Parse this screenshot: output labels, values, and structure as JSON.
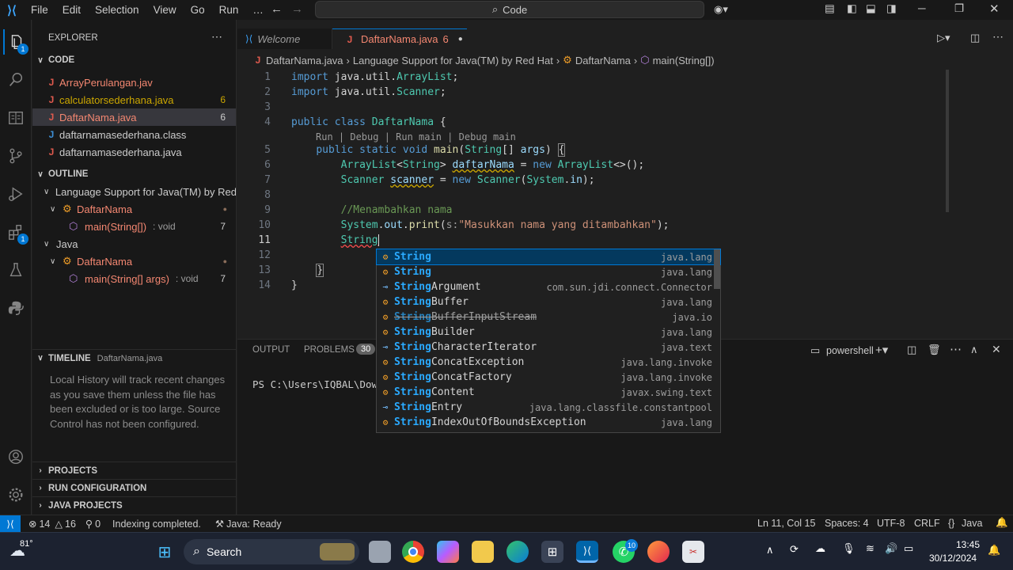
{
  "titlebar": {
    "menus": [
      "File",
      "Edit",
      "Selection",
      "View",
      "Go",
      "Run"
    ],
    "search": "Code",
    "more": "…"
  },
  "sidebar": {
    "explorer_title": "EXPLORER",
    "folder": "CODE",
    "files": [
      {
        "name": "ArrayPerulangan.jav",
        "count": ""
      },
      {
        "name": "calculatorsederhana.java",
        "count": "6"
      },
      {
        "name": "DaftarNama.java",
        "count": "6"
      },
      {
        "name": "daftarnamasederhana.class",
        "count": ""
      },
      {
        "name": "daftarnamasederhana.java",
        "count": ""
      }
    ],
    "outline": "OUTLINE",
    "outline_items": [
      {
        "label": "Language Support for Java(TM) by Red",
        "detail": "",
        "count": ""
      },
      {
        "label": "DaftarNama",
        "detail": "",
        "count": ""
      },
      {
        "label": "main(String[])",
        "detail": ": void",
        "count": "7"
      },
      {
        "label": "Java",
        "detail": "",
        "count": ""
      },
      {
        "label": "DaftarNama",
        "detail": "",
        "count": ""
      },
      {
        "label": "main(String[] args)",
        "detail": ": void",
        "count": "7"
      }
    ],
    "timeline": "TIMELINE",
    "timeline_file": "DaftarNama.java",
    "timeline_msg": "Local History will track recent changes as you save them unless the file has been excluded or is too large. Source Control has not been configured.",
    "projects": "PROJECTS",
    "run_config": "RUN CONFIGURATION",
    "java_projects": "JAVA PROJECTS"
  },
  "tabs": [
    {
      "label": "Welcome"
    },
    {
      "label": "DaftarNama.java",
      "count": "6"
    }
  ],
  "breadcrumb": [
    "DaftarNama.java",
    "Language Support for Java(TM) by Red Hat",
    "DaftarNama",
    "main(String[])"
  ],
  "codelens": "Run | Debug | Run main | Debug main",
  "line_numbers": [
    "1",
    "2",
    "3",
    "4",
    "5",
    "6",
    "7",
    "8",
    "9",
    "10",
    "11",
    "12",
    "13",
    "14"
  ],
  "suggestions": [
    {
      "m": "String",
      "r": "",
      "d": "java.lang",
      "icon": "class"
    },
    {
      "m": "String",
      "r": "",
      "d": "java.lang",
      "icon": "class"
    },
    {
      "m": "String",
      "r": "Argument",
      "d": "com.sun.jdi.connect.Connector",
      "icon": "interface"
    },
    {
      "m": "String",
      "r": "Buffer",
      "d": "java.lang",
      "icon": "class"
    },
    {
      "m": "String",
      "r": "BufferInputStream",
      "d": "java.io",
      "icon": "class"
    },
    {
      "m": "String",
      "r": "Builder",
      "d": "java.lang",
      "icon": "class"
    },
    {
      "m": "String",
      "r": "CharacterIterator",
      "d": "java.text",
      "icon": "interface"
    },
    {
      "m": "String",
      "r": "ConcatException",
      "d": "java.lang.invoke",
      "icon": "class"
    },
    {
      "m": "String",
      "r": "ConcatFactory",
      "d": "java.lang.invoke",
      "icon": "class"
    },
    {
      "m": "String",
      "r": "Content",
      "d": "javax.swing.text",
      "icon": "class"
    },
    {
      "m": "String",
      "r": "Entry",
      "d": "java.lang.classfile.constantpool",
      "icon": "interface"
    },
    {
      "m": "String",
      "r": "IndexOutOfBoundsException",
      "d": "java.lang",
      "icon": "class"
    }
  ],
  "panel": {
    "output": "OUTPUT",
    "problems": "PROBLEMS",
    "problems_count": "30",
    "terminal": "powershell",
    "prompt": "PS C:\\Users\\IQBAL\\Dow"
  },
  "status": {
    "errors": "14",
    "warnings": "16",
    "ports": "0",
    "indexing": "Indexing completed.",
    "java": "Java: Ready",
    "position": "Ln 11, Col 15",
    "spaces": "Spaces: 4",
    "encoding": "UTF-8",
    "eol": "CRLF",
    "lang": "Java"
  },
  "taskbar": {
    "temp": "81°",
    "search": "Search",
    "time": "13:45",
    "date": "30/12/2024",
    "whatsapp_count": "10"
  },
  "colors": {
    "accent": "#0078d4",
    "error": "#f48771",
    "keyword": "#569cd6",
    "type": "#4ec9b0"
  }
}
